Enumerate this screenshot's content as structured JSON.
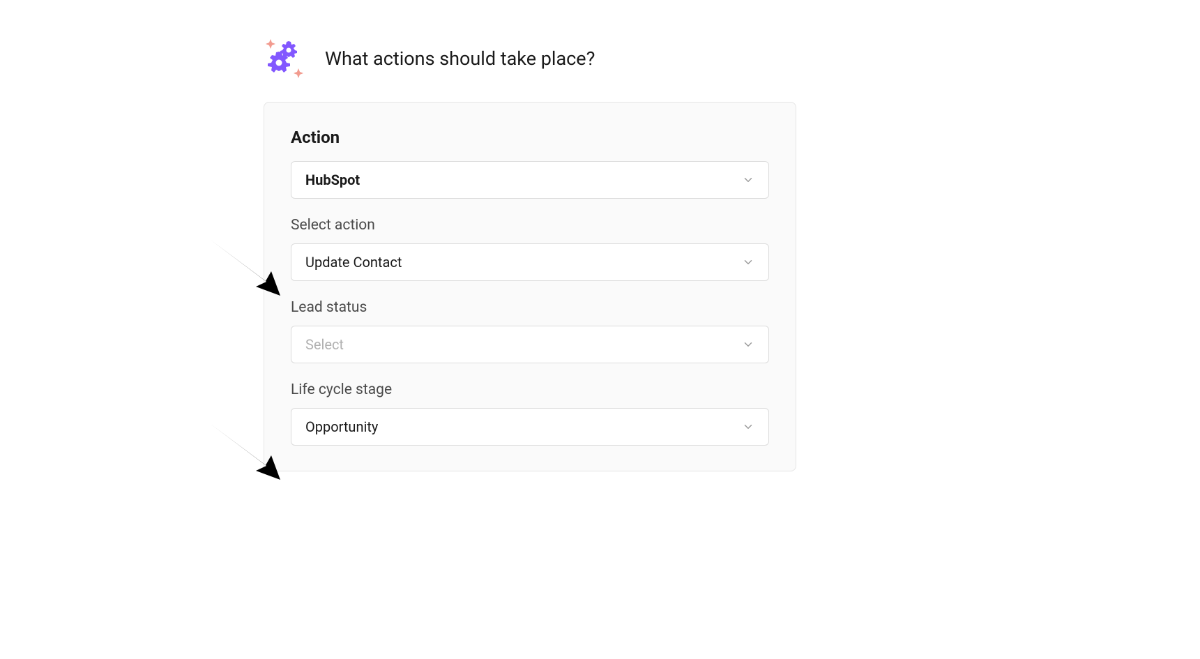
{
  "header": {
    "title": "What actions should take place?"
  },
  "card": {
    "section_title": "Action",
    "integration": {
      "value": "HubSpot"
    },
    "action": {
      "label": "Select action",
      "value": "Update Contact"
    },
    "lead_status": {
      "label": "Lead status",
      "placeholder": "Select"
    },
    "lifecycle": {
      "label": "Life cycle stage",
      "value": "Opportunity"
    }
  }
}
